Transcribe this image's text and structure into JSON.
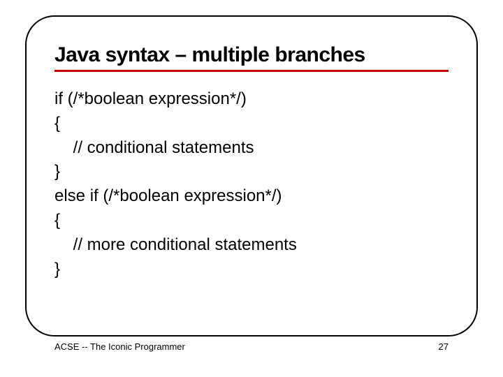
{
  "slide": {
    "title": "Java syntax – multiple branches",
    "code": {
      "l1": "if (/*boolean expression*/)",
      "l2": "{",
      "l3": "    // conditional statements",
      "l4": "}",
      "l5": "else if (/*boolean expression*/)",
      "l6": "{",
      "l7": "    // more conditional statements",
      "l8": "}"
    }
  },
  "footer": {
    "left": "ACSE -- The Iconic Programmer",
    "right": "27"
  }
}
